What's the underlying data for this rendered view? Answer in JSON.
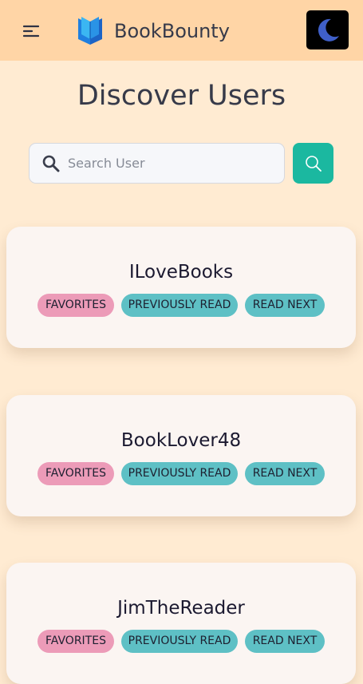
{
  "header": {
    "brand": "BookBounty"
  },
  "page": {
    "title": "Discover Users"
  },
  "search": {
    "placeholder": "Search User",
    "value": ""
  },
  "tags": {
    "favorites": "FAVORITES",
    "previously_read": "PREVIOUSLY READ",
    "read_next": "READ NEXT"
  },
  "users": [
    {
      "name": "ILoveBooks"
    },
    {
      "name": "BookLover48"
    },
    {
      "name": "JimTheReader"
    }
  ],
  "icons": {
    "menu": "menu-icon",
    "logo": "book-logo-icon",
    "theme": "moon-icon",
    "search": "search-icon"
  },
  "colors": {
    "header_bg": "#ffd5a6",
    "page_bg": "#ffebd2",
    "accent": "#1bb8a0",
    "favorites_tag": "#ec9bb8",
    "list_tag": "#5ec0c5"
  }
}
